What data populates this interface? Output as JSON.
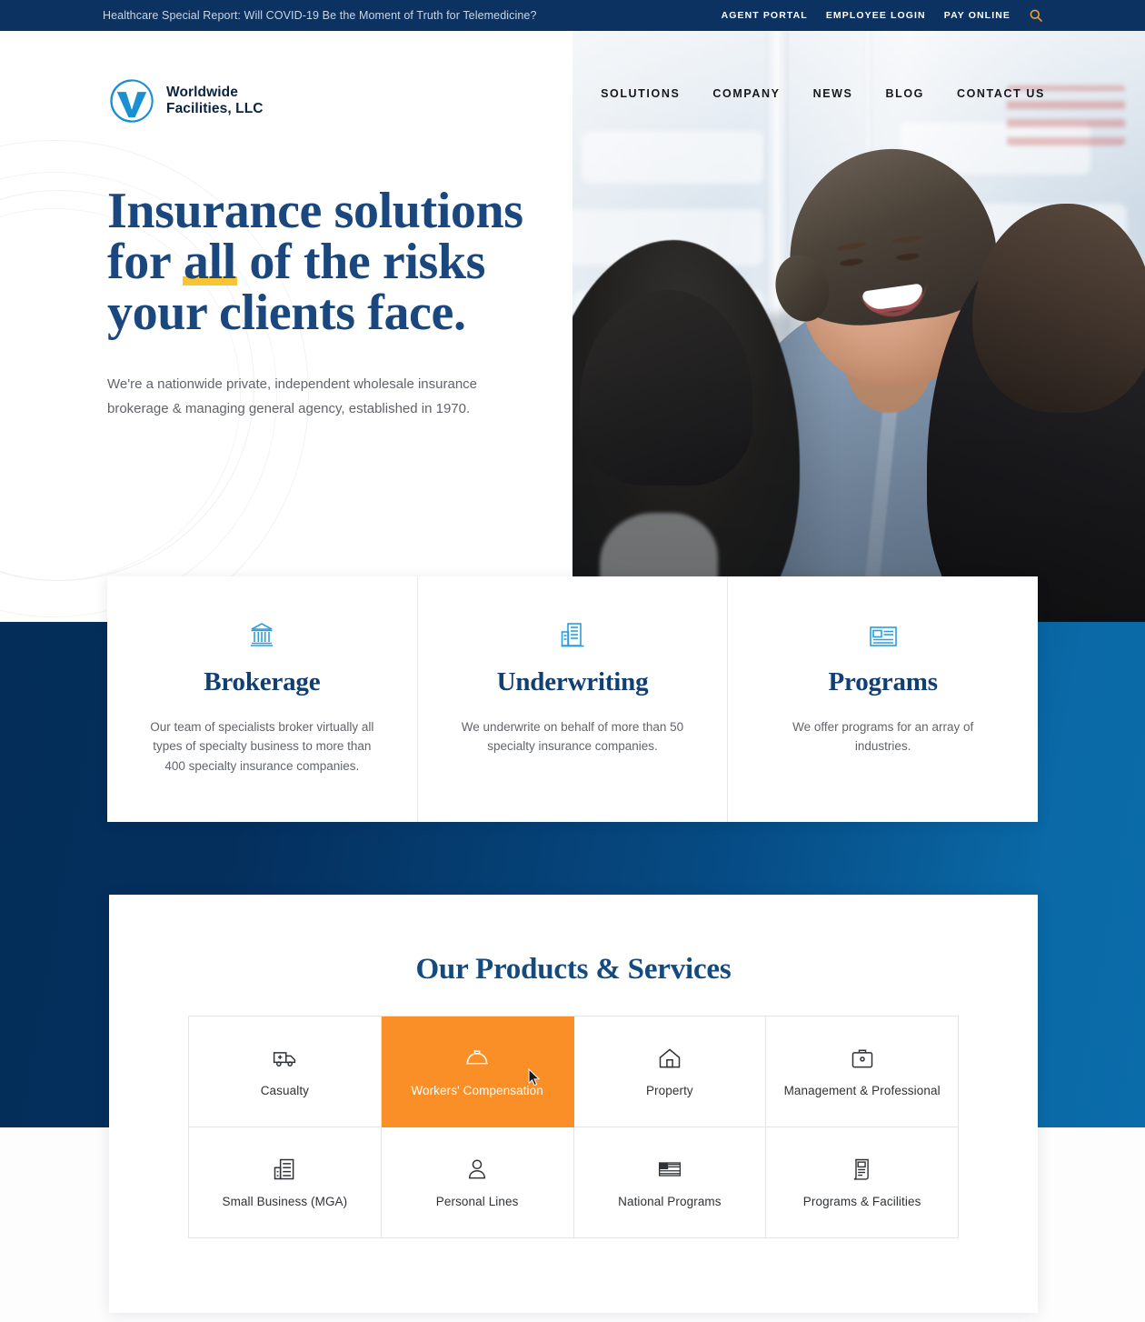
{
  "topbar": {
    "news": "Healthcare Special Report: Will COVID-19 Be the Moment of Truth for Telemedicine?",
    "links": [
      {
        "label": "AGENT PORTAL"
      },
      {
        "label": "EMPLOYEE LOGIN"
      },
      {
        "label": "PAY ONLINE"
      }
    ],
    "search_icon": "search-icon"
  },
  "brand": {
    "line1": "Worldwide",
    "line2": "Facilities, LLC",
    "mark": "w-circle-logo-icon"
  },
  "nav": {
    "items": [
      {
        "label": "SOLUTIONS"
      },
      {
        "label": "COMPANY"
      },
      {
        "label": "NEWS"
      },
      {
        "label": "BLOG"
      },
      {
        "label": "CONTACT US"
      }
    ]
  },
  "hero": {
    "title_part1": "Insurance solutions for ",
    "title_highlight": "all",
    "title_part2": " of the risks your clients face.",
    "subtitle": "We're a nationwide private, independent wholesale insurance brokerage & managing general agency, established in 1970.",
    "image_alt": "business-meeting-photo"
  },
  "features": [
    {
      "icon": "bank-columns-icon",
      "title": "Brokerage",
      "desc": "Our team of specialists broker virtually all types of specialty business to more than 400 specialty insurance companies."
    },
    {
      "icon": "office-building-icon",
      "title": "Underwriting",
      "desc": "We underwrite on behalf of more than 50 specialty insurance companies."
    },
    {
      "icon": "id-card-icon",
      "title": "Programs",
      "desc": "We offer programs for an array of industries."
    }
  ],
  "products": {
    "title": "Our Products & Services",
    "items": [
      {
        "label": "Casualty",
        "icon": "ambulance-icon",
        "active": false
      },
      {
        "label": "Workers' Compensation",
        "icon": "hard-hat-icon",
        "active": true
      },
      {
        "label": "Property",
        "icon": "house-icon",
        "active": false
      },
      {
        "label": "Management & Professional",
        "icon": "briefcase-icon",
        "active": false
      },
      {
        "label": "Small Business (MGA)",
        "icon": "building-icon",
        "active": false
      },
      {
        "label": "Personal Lines",
        "icon": "person-icon",
        "active": false
      },
      {
        "label": "National Programs",
        "icon": "flag-icon",
        "active": false
      },
      {
        "label": "Programs & Facilities",
        "icon": "document-building-icon",
        "active": false
      }
    ]
  },
  "colors": {
    "navy": "#0b3260",
    "headline_blue": "#19477e",
    "accent_orange": "#fa8f28",
    "highlight_yellow": "#f8c432",
    "icon_blue": "#2a9ee0",
    "band_dark": "#042d59",
    "band_light": "#0b6cab"
  }
}
